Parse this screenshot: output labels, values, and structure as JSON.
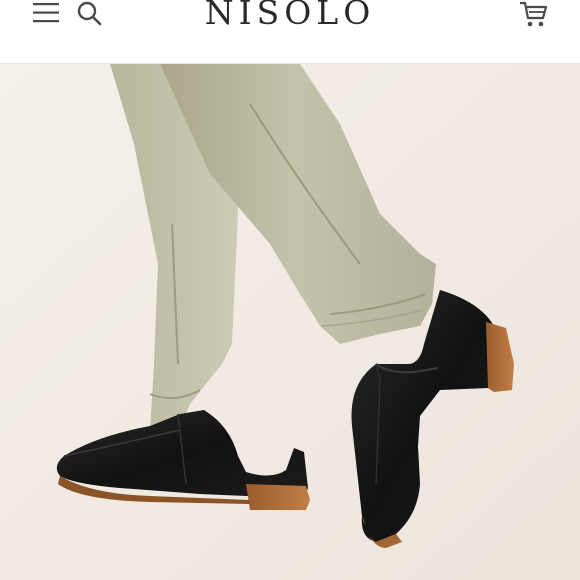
{
  "header": {
    "brand": "NISOLO",
    "menu_icon": "hamburger-menu-icon",
    "search_icon": "search-icon",
    "cart_icon": "shopping-cart-icon"
  },
  "hero": {
    "image": "product-photo-black-leather-loafers"
  },
  "colors": {
    "header_bg": "#ffffff",
    "brand_text": "#2a2a2a",
    "icon": "#4a4a4a",
    "photo_bg": "#f1ece6",
    "leather": "#141414",
    "sole": "#b06f3c"
  }
}
